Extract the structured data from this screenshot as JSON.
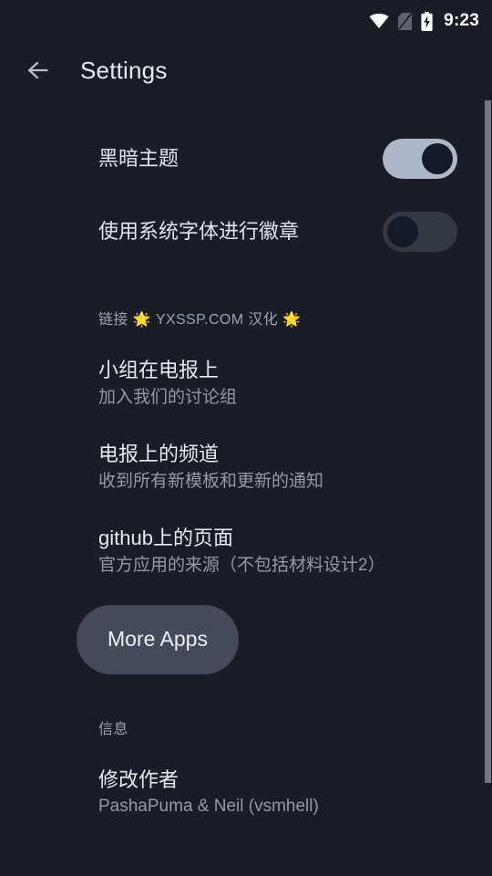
{
  "status_bar": {
    "wifi_icon": "wifi-icon",
    "sim_icon": "sim-card-disabled-icon",
    "battery_icon": "battery-charging-icon",
    "time": "9:23"
  },
  "app_bar": {
    "back_icon": "arrow-left-icon",
    "title": "Settings"
  },
  "toggles": [
    {
      "label": "黑暗主题",
      "state": "on"
    },
    {
      "label": "使用系统字体进行徽章",
      "state": "off"
    }
  ],
  "links_section": {
    "header": "链接 🌟 YXSSP.COM 汉化 🌟",
    "items": [
      {
        "title": "小组在电报上",
        "subtitle": "加入我们的讨论组"
      },
      {
        "title": "电报上的频道",
        "subtitle": "收到所有新模板和更新的通知"
      },
      {
        "title": "github上的页面",
        "subtitle": "官方应用的来源（不包括材料设计2）"
      }
    ],
    "more_apps_label": "More Apps"
  },
  "info_section": {
    "header": "信息",
    "items": [
      {
        "title": "修改作者",
        "subtitle": "PashaPuma & Neil (vsmhell)"
      }
    ]
  },
  "colors": {
    "background": "#1a1d26",
    "primary_text": "#e8eaf0",
    "secondary_text": "#9499a6",
    "switch_on_track": "#aeb6c8",
    "switch_off_track": "#343843",
    "switch_thumb": "#151a28",
    "button_background": "#444a5a",
    "scrollbar": "#72767f"
  }
}
